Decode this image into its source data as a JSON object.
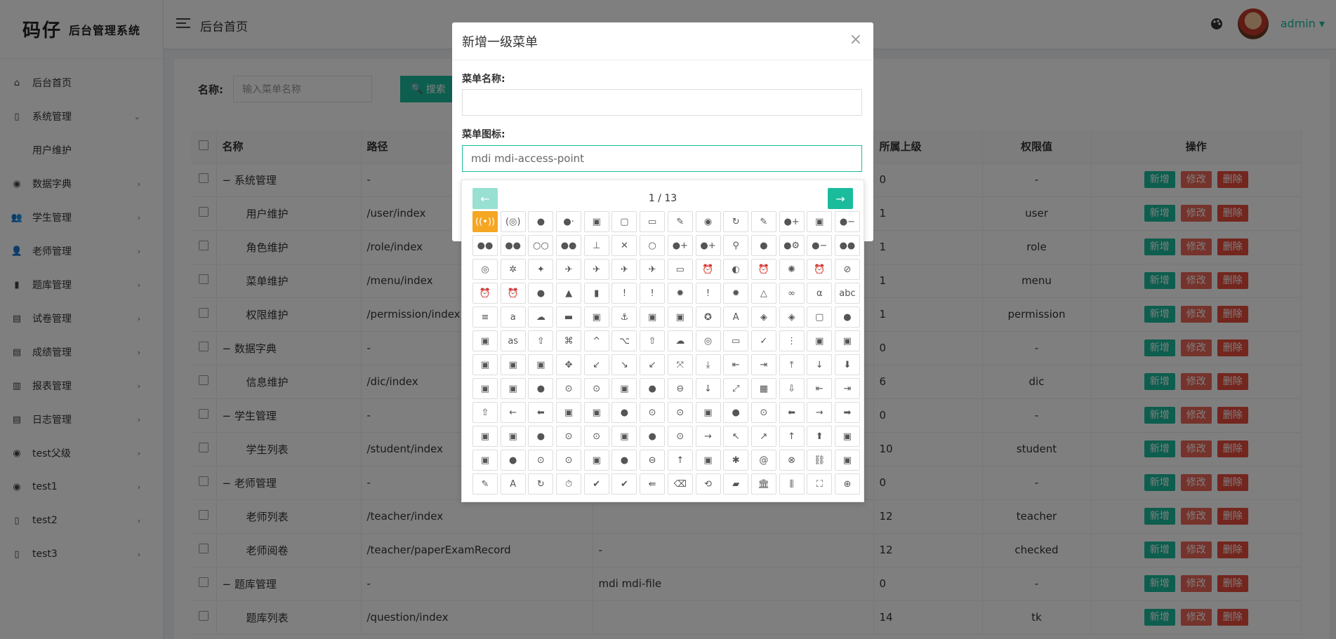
{
  "logo": {
    "big": "码仔",
    "small": "后台管理系统"
  },
  "sidebar": {
    "items": [
      {
        "label": "后台首页",
        "icon": "⌂",
        "arrow": ""
      },
      {
        "label": "系统管理",
        "icon": "▯",
        "arrow": "⌄"
      },
      {
        "label": "用户维护",
        "icon": "",
        "arrow": ""
      },
      {
        "label": "数据字典",
        "icon": "◉",
        "arrow": "›"
      },
      {
        "label": "学生管理",
        "icon": "👥",
        "arrow": "›"
      },
      {
        "label": "老师管理",
        "icon": "👤",
        "arrow": "›"
      },
      {
        "label": "题库管理",
        "icon": "▮",
        "arrow": "›"
      },
      {
        "label": "试卷管理",
        "icon": "▤",
        "arrow": "›"
      },
      {
        "label": "成绩管理",
        "icon": "▤",
        "arrow": "›"
      },
      {
        "label": "报表管理",
        "icon": "▥",
        "arrow": "›"
      },
      {
        "label": "日志管理",
        "icon": "▤",
        "arrow": "›"
      },
      {
        "label": "test父级",
        "icon": "◉",
        "arrow": "›"
      },
      {
        "label": "test1",
        "icon": "◉",
        "arrow": "›"
      },
      {
        "label": "test2",
        "icon": "▯",
        "arrow": "›"
      },
      {
        "label": "test3",
        "icon": "▯",
        "arrow": "›"
      }
    ]
  },
  "header": {
    "breadcrumb": "后台首页",
    "user": "admin ▾"
  },
  "search": {
    "label": "名称:",
    "placeholder": "输入菜单名称",
    "button": "搜索",
    "button_icon": "🔍"
  },
  "table": {
    "headers": [
      "名称",
      "路径",
      "",
      "所属上级",
      "权限值",
      "操作"
    ],
    "actions": {
      "add": "新增",
      "edit": "修改",
      "del": "删除"
    },
    "rows": [
      {
        "name": "− 系统管理",
        "path": "-",
        "icon": "",
        "parent": "0",
        "perm": "-",
        "child": false
      },
      {
        "name": "用户维护",
        "path": "/user/index",
        "icon": "",
        "parent": "1",
        "perm": "user",
        "child": true
      },
      {
        "name": "角色维护",
        "path": "/role/index",
        "icon": "",
        "parent": "1",
        "perm": "role",
        "child": true
      },
      {
        "name": "菜单维护",
        "path": "/menu/index",
        "icon": "",
        "parent": "1",
        "perm": "menu",
        "child": true
      },
      {
        "name": "权限维护",
        "path": "/permission/index",
        "icon": "",
        "parent": "1",
        "perm": "permission",
        "child": true
      },
      {
        "name": "− 数据字典",
        "path": "-",
        "icon": "",
        "parent": "0",
        "perm": "-",
        "child": false
      },
      {
        "name": "信息维护",
        "path": "/dic/index",
        "icon": "",
        "parent": "6",
        "perm": "dic",
        "child": true
      },
      {
        "name": "− 学生管理",
        "path": "-",
        "icon": "",
        "parent": "0",
        "perm": "-",
        "child": false
      },
      {
        "name": "学生列表",
        "path": "/student/index",
        "icon": "",
        "parent": "10",
        "perm": "student",
        "child": true
      },
      {
        "name": "− 老师管理",
        "path": "-",
        "icon": "",
        "parent": "0",
        "perm": "-",
        "child": false
      },
      {
        "name": "老师列表",
        "path": "/teacher/index",
        "icon": "",
        "parent": "12",
        "perm": "teacher",
        "child": true
      },
      {
        "name": "老师阅卷",
        "path": "/teacher/paperExamRecord",
        "icon": "-",
        "parent": "12",
        "perm": "checked",
        "child": true
      },
      {
        "name": "− 题库管理",
        "path": "-",
        "icon": "mdi mdi-file",
        "parent": "0",
        "perm": "-",
        "child": false
      },
      {
        "name": "题库列表",
        "path": "/question/index",
        "icon": "",
        "parent": "14",
        "perm": "tk",
        "child": true
      }
    ]
  },
  "dialog": {
    "title": "新增一级菜单",
    "close": "×",
    "name_label": "菜单名称:",
    "name_value": "",
    "icon_label": "菜单图标:",
    "icon_value": "mdi mdi-access-point"
  },
  "picker": {
    "page": "1 / 13",
    "prev": "←",
    "next": "→",
    "icons": [
      "((•))",
      "(◎)",
      "●",
      "●·",
      "▣",
      "▢",
      "▭",
      "✎",
      "◉",
      "↻",
      "✎",
      "●+",
      "▣",
      "●−",
      "●●",
      "●●",
      "○○",
      "●●",
      "⊥",
      "✕",
      "○",
      "●+",
      "●+",
      "⚲",
      "●",
      "●⚙",
      "●−",
      "●●",
      "◎",
      "✲",
      "✦",
      "✈",
      "✈",
      "✈",
      "✈",
      "▭",
      "⏰",
      "◐",
      "⏰",
      "✺",
      "⏰",
      "⊘",
      "⏰",
      "⏰",
      "●",
      "▲",
      "▮",
      "!",
      "!",
      "✹",
      "!",
      "✹",
      "△",
      "∞",
      "α",
      "abc",
      "≡",
      "a",
      "☁",
      "▬",
      "▣",
      "⚓",
      "▣",
      "▣",
      "✪",
      "A",
      "◈",
      "◈",
      "▢",
      "●",
      "▣",
      "as",
      "⇧",
      "⌘",
      "^",
      "⌥",
      "⇧",
      "☁",
      "◎",
      "▭",
      "✓",
      "⋮",
      "▣",
      "▣",
      "▣",
      "▣",
      "▣",
      "✥",
      "↙",
      "↘",
      "↙",
      "⤧",
      "⤓",
      "⇤",
      "⇥",
      "⤒",
      "↓",
      "⬇",
      "▣",
      "▣",
      "●",
      "⊙",
      "⊙",
      "▣",
      "●",
      "⊖",
      "↓",
      "⤢",
      "▦",
      "⇩",
      "⇤",
      "⇥",
      "⇧",
      "←",
      "⬅",
      "▣",
      "▣",
      "●",
      "⊙",
      "⊙",
      "▣",
      "●",
      "⊙",
      "⬅",
      "→",
      "➡",
      "▣",
      "▣",
      "●",
      "⊙",
      "⊙",
      "▣",
      "●",
      "⊙",
      "→",
      "↖",
      "↗",
      "↑",
      "⬆",
      "▣",
      "▣",
      "●",
      "⊙",
      "⊙",
      "▣",
      "●",
      "⊖",
      "↑",
      "▣",
      "✱",
      "@",
      "⊗",
      "⛓",
      "▣",
      "✎",
      "A",
      "↻",
      "⏱",
      "✔",
      "✔",
      "⇚",
      "⌫",
      "⟲",
      "▰",
      "🏛",
      "⫼",
      "⛶",
      "⊕"
    ]
  },
  "colors": {
    "accent": "#1abc9c",
    "danger": "#e74c3c",
    "selected": "#f5a623"
  }
}
